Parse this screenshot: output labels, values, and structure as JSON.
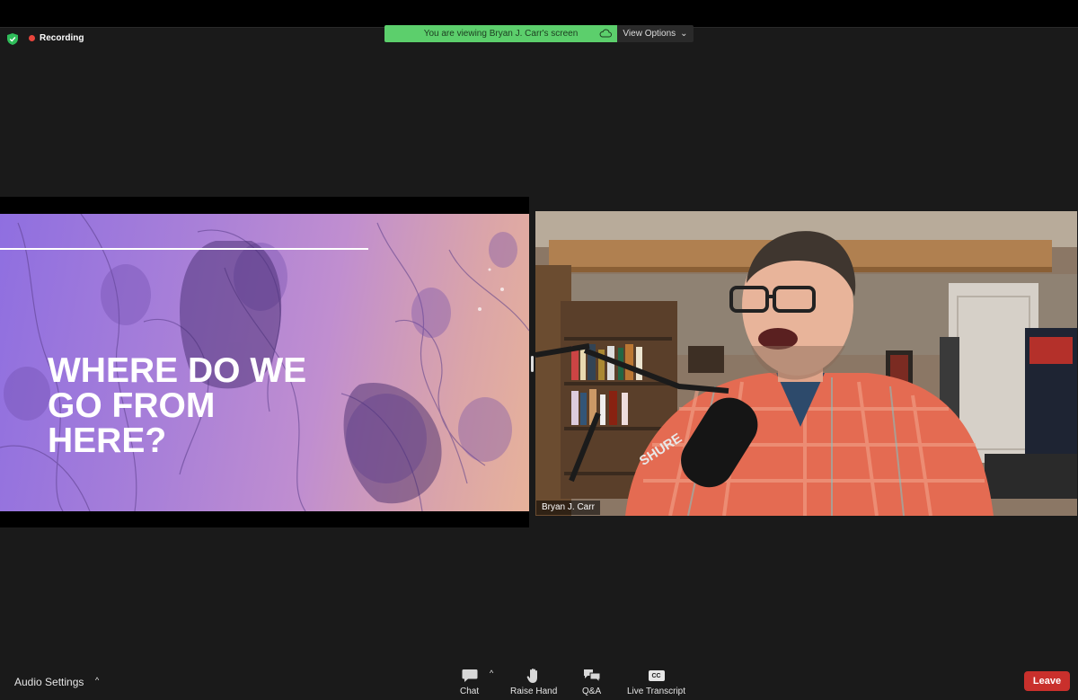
{
  "meeting": {
    "recording_label": "Recording",
    "share_banner": "You are viewing Bryan J. Carr's screen",
    "view_options_label": "View Options",
    "view_options_caret": "⌄"
  },
  "slide": {
    "title_lines": [
      "WHERE DO WE",
      "GO FROM",
      "HERE?"
    ]
  },
  "participant": {
    "name": "Bryan J. Carr"
  },
  "toolbar": {
    "audio_settings_label": "Audio Settings",
    "audio_caret": "^",
    "chat_label": "Chat",
    "chat_caret": "^",
    "raise_hand_label": "Raise Hand",
    "qa_label": "Q&A",
    "live_transcript_label": "Live Transcript",
    "cc_text": "CC",
    "leave_label": "Leave"
  },
  "colors": {
    "banner_green": "#5ccf6c",
    "leave_red": "#c9302c",
    "recording_red": "#e8453c"
  }
}
